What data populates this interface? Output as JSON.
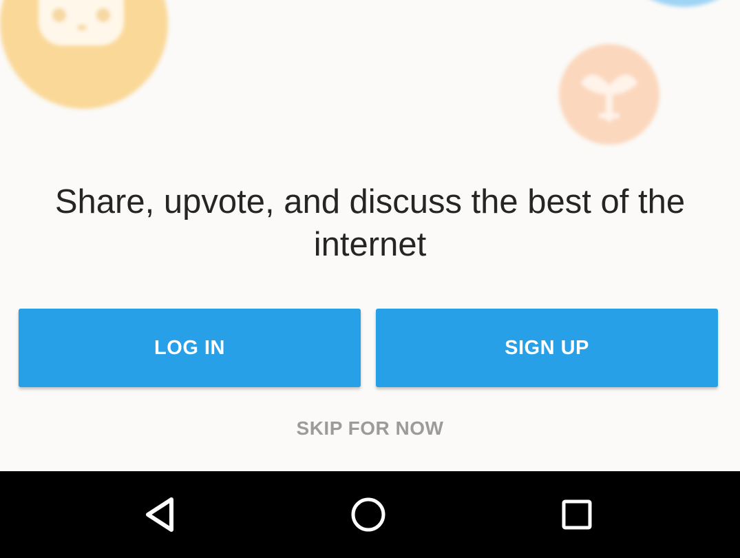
{
  "tagline": "Share, upvote, and discuss the best of the internet",
  "buttons": {
    "login_label": "LOG IN",
    "signup_label": "SIGN UP",
    "skip_label": "SKIP FOR NOW"
  },
  "colors": {
    "accent": "#28a0e8",
    "background": "#fbfaf8",
    "text": "#252525",
    "muted_text": "#9b9b9b",
    "nav_bar": "#000000"
  },
  "decorations": [
    {
      "icon": "cat-avatar-icon",
      "color": "#fad898"
    },
    {
      "icon": "plant-avatar-icon",
      "color": "#fbd7bd"
    },
    {
      "icon": "blue-avatar-icon",
      "color": "#9fd4f4"
    }
  ],
  "nav": {
    "back_icon": "back-triangle-icon",
    "home_icon": "home-circle-icon",
    "recents_icon": "recents-square-icon"
  }
}
